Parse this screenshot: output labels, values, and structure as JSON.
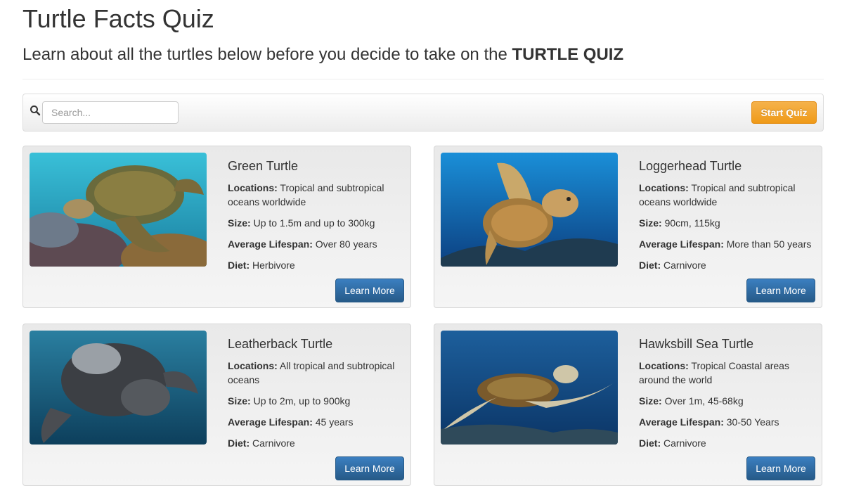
{
  "page": {
    "title": "Turtle Facts Quiz",
    "subtitle_prefix": "Learn about all the turtles below before you decide to take on the ",
    "subtitle_emphasis": "TURTLE QUIZ"
  },
  "toolbar": {
    "search_placeholder": "Search...",
    "start_label": "Start Quiz",
    "start_color": "#f0a12f"
  },
  "labels": {
    "locations": "Locations:",
    "size": "Size:",
    "lifespan": "Average Lifespan:",
    "diet": "Diet:",
    "learn_more": "Learn More"
  },
  "turtles": [
    {
      "name": "Green Turtle",
      "locations": "Tropical and subtropical oceans worldwide",
      "size": "Up to 1.5m and up to 300kg",
      "lifespan": "Over 80 years",
      "diet": "Herbivore",
      "image": "green-turtle-photo"
    },
    {
      "name": "Loggerhead Turtle",
      "locations": "Tropical and subtropical oceans worldwide",
      "size": "90cm, 115kg",
      "lifespan": "More than 50 years",
      "diet": "Carnivore",
      "image": "loggerhead-turtle-photo"
    },
    {
      "name": "Leatherback Turtle",
      "locations": "All tropical and subtropical oceans",
      "size": "Up to 2m, up to 900kg",
      "lifespan": "45 years",
      "diet": "Carnivore",
      "image": "leatherback-turtle-photo"
    },
    {
      "name": "Hawksbill Sea Turtle",
      "locations": "Tropical Coastal areas around the world",
      "size": "Over 1m, 45-68kg",
      "lifespan": "30-50 Years",
      "diet": "Carnivore",
      "image": "hawksbill-turtle-photo"
    }
  ]
}
